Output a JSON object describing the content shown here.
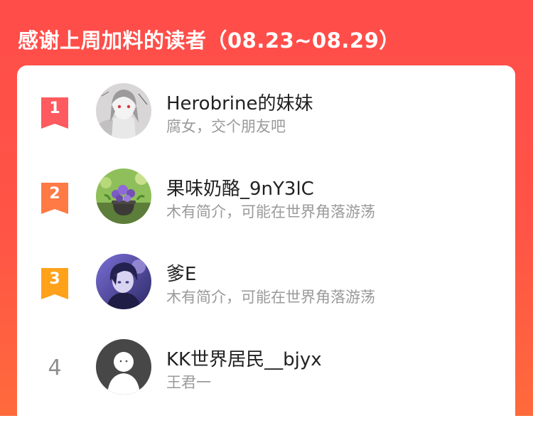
{
  "header": {
    "title": "感谢上周加料的读者（08.23~08.29）"
  },
  "colors": {
    "rank_1": "#ff5a5f",
    "rank_2": "#ff7a45",
    "rank_3": "#ffa21a",
    "rank_plain": "#8e8e8e"
  },
  "readers": [
    {
      "rank": "1",
      "name": "Herobrine的妹妹",
      "bio": "腐女，交个朋友吧",
      "avatar_icon": "anime-girl-avatar"
    },
    {
      "rank": "2",
      "name": "果味奶酪_9nY3lC",
      "bio": "木有简介，可能在世界角落游荡",
      "avatar_icon": "flower-pot-avatar"
    },
    {
      "rank": "3",
      "name": "爹E",
      "bio": "木有简介，可能在世界角落游荡",
      "avatar_icon": "anime-boy-avatar"
    },
    {
      "rank": "4",
      "name": "KK世界居民__bjyx",
      "bio": "王君一",
      "avatar_icon": "default-user-avatar"
    }
  ]
}
